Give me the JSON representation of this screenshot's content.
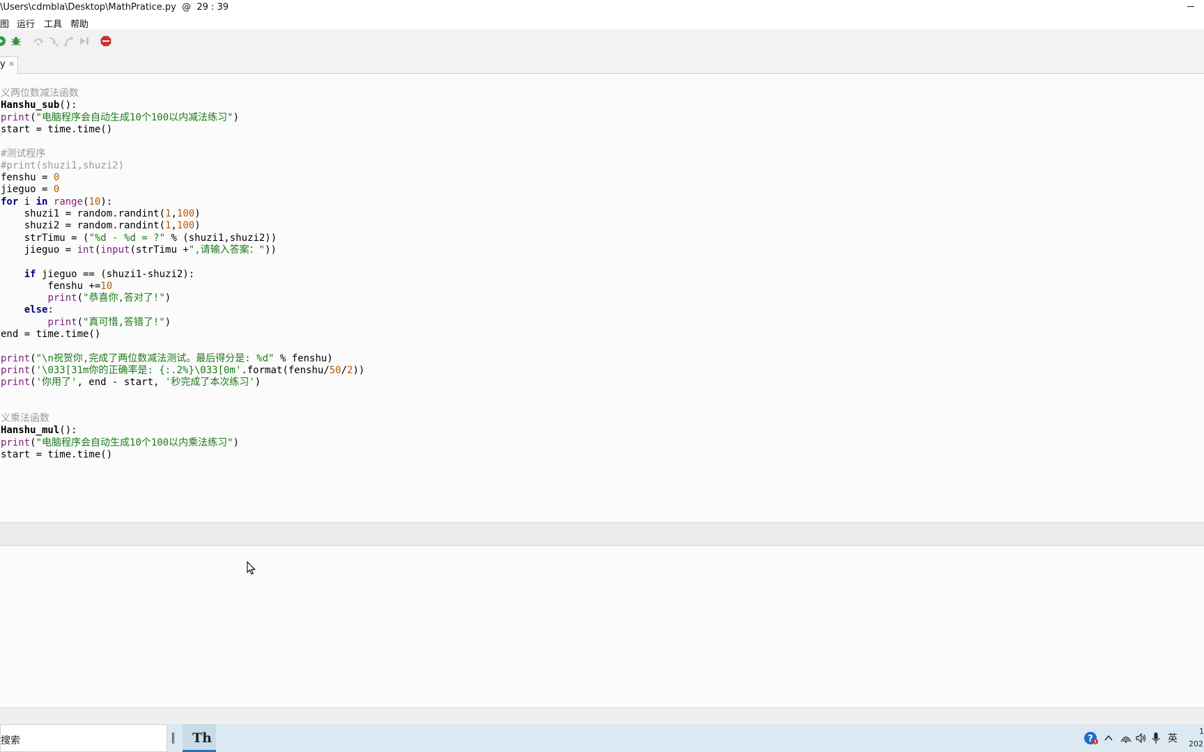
{
  "window": {
    "title": "\\Users\\cdmbla\\Desktop\\MathPratice.py  @  29 : 39"
  },
  "menu": {
    "items": [
      "图",
      "运行",
      "工具",
      "帮助"
    ]
  },
  "tab": {
    "label": "y",
    "close": "×"
  },
  "editor": {
    "lines": [
      {
        "segs": [
          {
            "t": "义两位数减法函数",
            "c": "cmt"
          }
        ]
      },
      {
        "segs": [
          {
            "t": "Hanshu_sub",
            "c": "defname"
          },
          {
            "t": "():",
            "c": ""
          }
        ]
      },
      {
        "segs": [
          {
            "t": "print",
            "c": "fn"
          },
          {
            "t": "(",
            "c": ""
          },
          {
            "t": "\"电脑程序会自动生成10个100以内减法练习\"",
            "c": "str"
          },
          {
            "t": ")",
            "c": ""
          }
        ]
      },
      {
        "segs": [
          {
            "t": "start = time.time()",
            "c": ""
          }
        ]
      },
      {
        "segs": []
      },
      {
        "segs": [
          {
            "t": "#测试程序",
            "c": "cmt"
          }
        ]
      },
      {
        "segs": [
          {
            "t": "#print(shuzi1,shuzi2)",
            "c": "cmt"
          }
        ]
      },
      {
        "segs": [
          {
            "t": "fenshu = ",
            "c": ""
          },
          {
            "t": "0",
            "c": "num"
          }
        ]
      },
      {
        "segs": [
          {
            "t": "jieguo = ",
            "c": ""
          },
          {
            "t": "0",
            "c": "num"
          }
        ]
      },
      {
        "segs": [
          {
            "t": "for",
            "c": "kw"
          },
          {
            "t": " i ",
            "c": ""
          },
          {
            "t": "in",
            "c": "kw"
          },
          {
            "t": " ",
            "c": ""
          },
          {
            "t": "range",
            "c": "fn"
          },
          {
            "t": "(",
            "c": ""
          },
          {
            "t": "10",
            "c": "num"
          },
          {
            "t": "):",
            "c": ""
          }
        ]
      },
      {
        "segs": [
          {
            "t": "    shuzi1 = random.randint(",
            "c": ""
          },
          {
            "t": "1",
            "c": "num"
          },
          {
            "t": ",",
            "c": ""
          },
          {
            "t": "100",
            "c": "num"
          },
          {
            "t": ")",
            "c": ""
          }
        ]
      },
      {
        "segs": [
          {
            "t": "    shuzi2 = random.randint(",
            "c": ""
          },
          {
            "t": "1",
            "c": "num"
          },
          {
            "t": ",",
            "c": ""
          },
          {
            "t": "100",
            "c": "num"
          },
          {
            "t": ")",
            "c": ""
          }
        ]
      },
      {
        "segs": [
          {
            "t": "    strTimu = (",
            "c": ""
          },
          {
            "t": "\"%d - %d = ?\"",
            "c": "str"
          },
          {
            "t": " % (shuzi1,shuzi2))",
            "c": ""
          }
        ]
      },
      {
        "segs": [
          {
            "t": "    jieguo = ",
            "c": ""
          },
          {
            "t": "int",
            "c": "fn"
          },
          {
            "t": "(",
            "c": ""
          },
          {
            "t": "input",
            "c": "fn"
          },
          {
            "t": "(strTimu +",
            "c": ""
          },
          {
            "t": "\",请输入答案：\"",
            "c": "str"
          },
          {
            "t": "))",
            "c": ""
          }
        ]
      },
      {
        "segs": []
      },
      {
        "segs": [
          {
            "t": "    ",
            "c": ""
          },
          {
            "t": "if",
            "c": "kw"
          },
          {
            "t": " jieguo == (shuzi1-shuzi2):",
            "c": ""
          }
        ]
      },
      {
        "segs": [
          {
            "t": "        fenshu +=",
            "c": ""
          },
          {
            "t": "10",
            "c": "num"
          }
        ]
      },
      {
        "segs": [
          {
            "t": "        ",
            "c": ""
          },
          {
            "t": "print",
            "c": "fn"
          },
          {
            "t": "(",
            "c": ""
          },
          {
            "t": "\"恭喜你,答对了!\"",
            "c": "str"
          },
          {
            "t": ")",
            "c": ""
          }
        ]
      },
      {
        "segs": [
          {
            "t": "    ",
            "c": ""
          },
          {
            "t": "else",
            "c": "kw"
          },
          {
            "t": ":",
            "c": ""
          }
        ]
      },
      {
        "segs": [
          {
            "t": "        ",
            "c": ""
          },
          {
            "t": "print",
            "c": "fn"
          },
          {
            "t": "(",
            "c": ""
          },
          {
            "t": "\"真可惜,答错了!\"",
            "c": "str"
          },
          {
            "t": ")",
            "c": ""
          }
        ]
      },
      {
        "segs": [
          {
            "t": "end = time.time()",
            "c": ""
          }
        ]
      },
      {
        "segs": []
      },
      {
        "segs": [
          {
            "t": "print",
            "c": "fn"
          },
          {
            "t": "(",
            "c": ""
          },
          {
            "t": "\"\\n祝贺你,完成了两位数减法测试。最后得分是: %d\"",
            "c": "str"
          },
          {
            "t": " % fenshu)",
            "c": ""
          }
        ]
      },
      {
        "segs": [
          {
            "t": "print",
            "c": "fn"
          },
          {
            "t": "(",
            "c": ""
          },
          {
            "t": "'\\033[31m你的正确率是: {:.2%}\\033[0m'",
            "c": "str"
          },
          {
            "t": ".format(fenshu/",
            "c": ""
          },
          {
            "t": "50",
            "c": "num"
          },
          {
            "t": "/",
            "c": ""
          },
          {
            "t": "2",
            "c": "num"
          },
          {
            "t": "))",
            "c": ""
          }
        ]
      },
      {
        "segs": [
          {
            "t": "print",
            "c": "fn"
          },
          {
            "t": "(",
            "c": ""
          },
          {
            "t": "'你用了'",
            "c": "str"
          },
          {
            "t": ", end - start, ",
            "c": ""
          },
          {
            "t": "'秒完成了本次练习'",
            "c": "str"
          },
          {
            "t": ")",
            "c": ""
          }
        ]
      },
      {
        "segs": []
      },
      {
        "segs": []
      },
      {
        "segs": [
          {
            "t": "义乘法函数",
            "c": "cmt"
          }
        ]
      },
      {
        "segs": [
          {
            "t": "Hanshu_mul",
            "c": "defname"
          },
          {
            "t": "():",
            "c": ""
          }
        ]
      },
      {
        "segs": [
          {
            "t": "print",
            "c": "fn"
          },
          {
            "t": "(",
            "c": ""
          },
          {
            "t": "\"电脑程序会自动生成10个100以内乘法练习\"",
            "c": "str"
          },
          {
            "t": ")",
            "c": ""
          }
        ]
      },
      {
        "segs": [
          {
            "t": "start = time.time()",
            "c": ""
          }
        ]
      }
    ]
  },
  "taskbar": {
    "search_text": "搜索",
    "app_glyph": "Th",
    "ime": "英",
    "clock_line1": "1",
    "clock_line2": "202"
  },
  "colors": {
    "keyword": "#000080",
    "builtin": "#7d1f7d",
    "string": "#1a7a1a",
    "number": "#b35a00",
    "comment": "#9a9a9a",
    "run_green": "#2ea043",
    "stop_red": "#d32f2f"
  },
  "icons": [
    "run-icon",
    "debug-icon",
    "step-over-icon",
    "step-into-icon",
    "step-out-icon",
    "resume-icon",
    "stop-icon"
  ]
}
